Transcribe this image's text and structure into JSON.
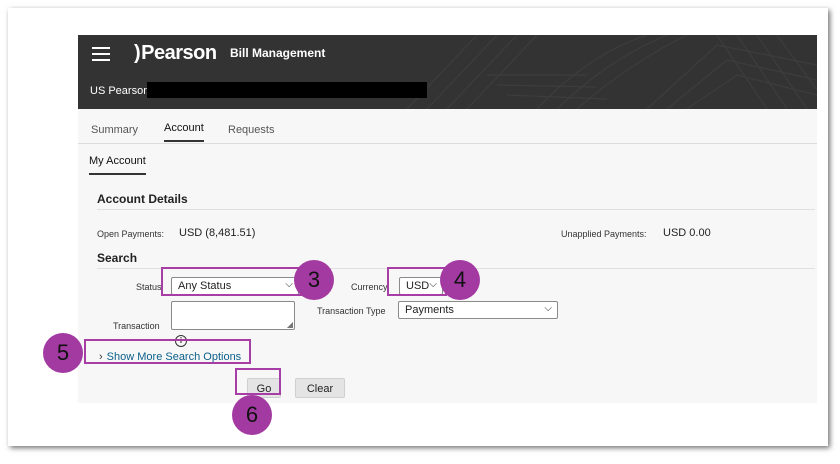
{
  "header": {
    "logo_text": "Pearson",
    "app_title": "Bill Management",
    "org_name": "US Pearson"
  },
  "tabs": [
    {
      "label": "Summary",
      "active": false
    },
    {
      "label": "Account",
      "active": true
    },
    {
      "label": "Requests",
      "active": false
    }
  ],
  "subtab": {
    "label": "My Account"
  },
  "account_details": {
    "heading": "Account Details",
    "open_payments_label": "Open Payments:",
    "open_payments_value": "USD (8,481.51)",
    "unapplied_payments_label": "Unapplied Payments:",
    "unapplied_payments_value": "USD 0.00"
  },
  "search": {
    "heading": "Search",
    "status_label": "Status",
    "status_value": "Any Status",
    "currency_label": "Currency",
    "currency_value": "USD",
    "transaction_label": "Transaction",
    "transaction_value": "",
    "transaction_type_label": "Transaction Type",
    "transaction_type_value": "Payments",
    "more_options_label": "Show More Search Options",
    "go_label": "Go",
    "clear_label": "Clear"
  },
  "callouts": {
    "status": "3",
    "currency": "4",
    "more_options": "5",
    "go": "6"
  },
  "colors": {
    "header_bg": "#333333",
    "annotation": "#a33aa1",
    "link": "#0a5f8a"
  }
}
